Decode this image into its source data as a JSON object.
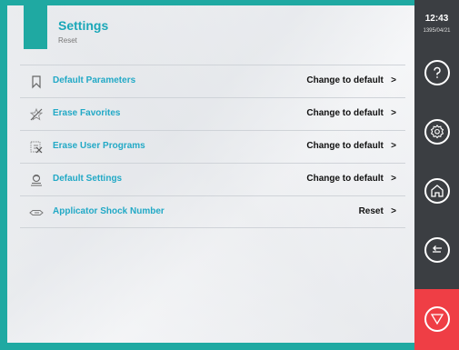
{
  "header": {
    "title": "Settings",
    "subtitle": "Reset"
  },
  "rows": [
    {
      "label": "Default Parameters",
      "action": "Change to default",
      "chevron": ">",
      "icon": "bookmark-icon"
    },
    {
      "label": "Erase Favorites",
      "action": "Change to default",
      "chevron": ">",
      "icon": "erase-star-icon"
    },
    {
      "label": "Erase User Programs",
      "action": "Change to default",
      "chevron": ">",
      "icon": "erase-list-icon"
    },
    {
      "label": "Default Settings",
      "action": "Change to default",
      "chevron": ">",
      "icon": "reset-user-icon"
    },
    {
      "label": "Applicator Shock Number",
      "action": "Reset",
      "chevron": ">",
      "icon": "applicator-icon"
    }
  ],
  "sidebar": {
    "time": "12:43",
    "date": "1395/04/21",
    "buttons": [
      "help-icon",
      "settings-gear-icon",
      "home-icon",
      "back-arrow-icon",
      "stop-icon"
    ]
  },
  "colors": {
    "accent": "#1fa9a2",
    "label": "#22a9c6",
    "sidebar": "#3b3e42",
    "stop": "#ef3e45"
  }
}
